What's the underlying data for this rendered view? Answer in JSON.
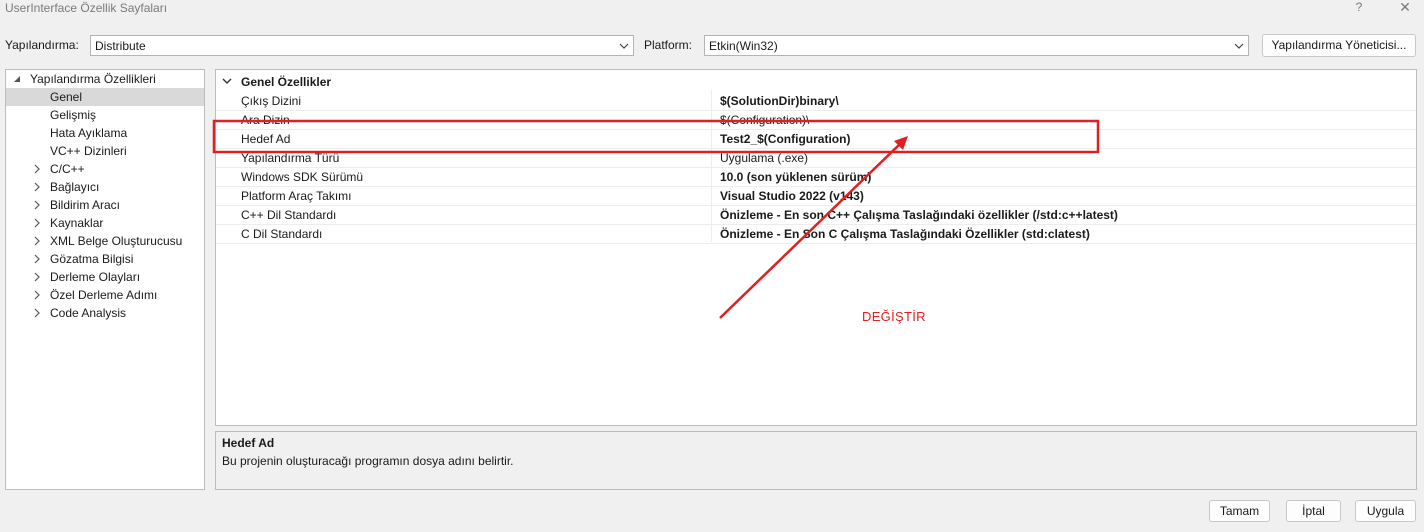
{
  "window": {
    "title": "UserInterface Özellik Sayfaları",
    "help_glyph": "?",
    "close_glyph": "✕"
  },
  "config_bar": {
    "config_label": "Yapılandırma:",
    "config_value": "Distribute",
    "platform_label": "Platform:",
    "platform_value": "Etkin(Win32)",
    "manager_button": "Yapılandırma Yöneticisi..."
  },
  "tree": {
    "root": "Yapılandırma Özellikleri",
    "items": [
      {
        "label": "Genel",
        "selected": true,
        "expandable": false
      },
      {
        "label": "Gelişmiş",
        "selected": false,
        "expandable": false
      },
      {
        "label": "Hata Ayıklama",
        "selected": false,
        "expandable": false
      },
      {
        "label": "VC++ Dizinleri",
        "selected": false,
        "expandable": false
      },
      {
        "label": "C/C++",
        "selected": false,
        "expandable": true
      },
      {
        "label": "Bağlayıcı",
        "selected": false,
        "expandable": true
      },
      {
        "label": "Bildirim Aracı",
        "selected": false,
        "expandable": true
      },
      {
        "label": "Kaynaklar",
        "selected": false,
        "expandable": true
      },
      {
        "label": "XML Belge Oluşturucusu",
        "selected": false,
        "expandable": true
      },
      {
        "label": "Gözatma Bilgisi",
        "selected": false,
        "expandable": true
      },
      {
        "label": "Derleme Olayları",
        "selected": false,
        "expandable": true
      },
      {
        "label": "Özel Derleme Adımı",
        "selected": false,
        "expandable": true
      },
      {
        "label": "Code Analysis",
        "selected": false,
        "expandable": true
      }
    ]
  },
  "grid": {
    "section": "Genel Özellikler",
    "rows": [
      {
        "name": "Çıkış Dizini",
        "value": "$(SolutionDir)binary\\",
        "bold": true
      },
      {
        "name": "Ara Dizin",
        "value": "$(Configuration)\\",
        "bold": false
      },
      {
        "name": "Hedef Ad",
        "value": "Test2_$(Configuration)",
        "bold": true
      },
      {
        "name": "Yapılandırma Türü",
        "value": "Uygulama (.exe)",
        "bold": false
      },
      {
        "name": "Windows SDK Sürümü",
        "value": "10.0 (son yüklenen sürüm)",
        "bold": true
      },
      {
        "name": "Platform Araç Takımı",
        "value": "Visual Studio 2022 (v143)",
        "bold": true
      },
      {
        "name": "C++ Dil Standardı",
        "value": "Önizleme - En son C++ Çalışma Taslağındaki özellikler (/std:c++latest)",
        "bold": true
      },
      {
        "name": "C Dil Standardı",
        "value": "Önizleme - En Son C Çalışma Taslağındaki Özellikler (std:clatest)",
        "bold": true
      }
    ]
  },
  "description": {
    "title": "Hedef Ad",
    "text": "Bu projenin oluşturacağı programın dosya adını belirtir."
  },
  "annotation": {
    "text": "DEĞİŞTİR",
    "color": "#e02020"
  },
  "buttons": {
    "ok": "Tamam",
    "cancel": "İptal",
    "apply": "Uygula"
  }
}
